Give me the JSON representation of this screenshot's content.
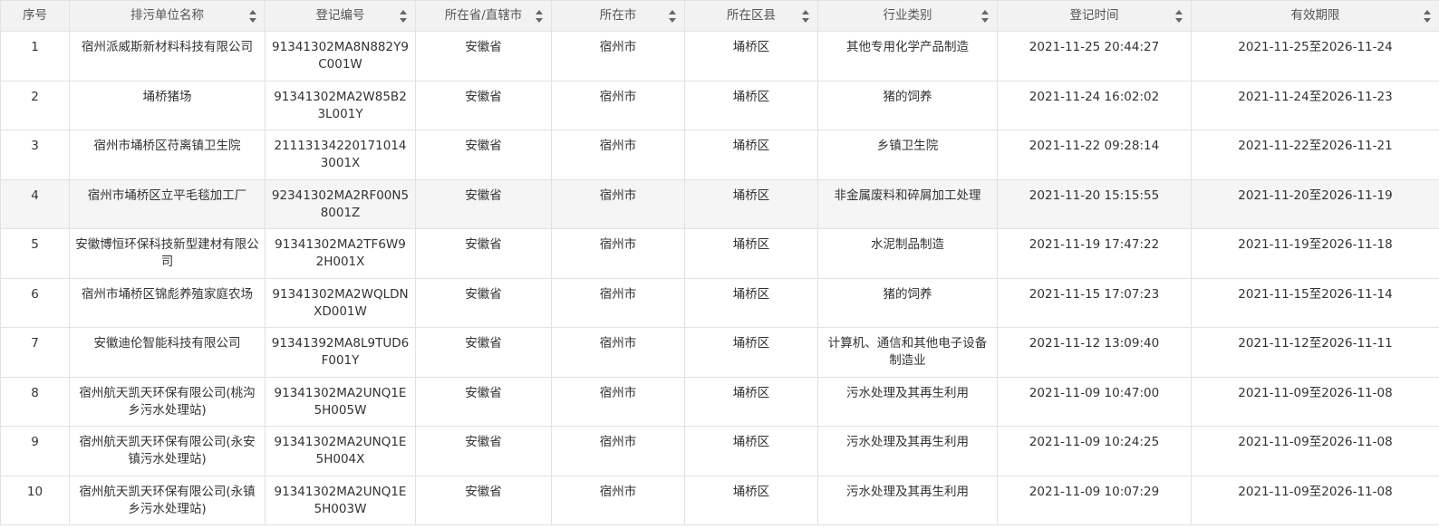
{
  "table": {
    "headers": [
      {
        "key": "seq",
        "label": "序号",
        "sortable": false
      },
      {
        "key": "name",
        "label": "排污单位名称",
        "sortable": true
      },
      {
        "key": "reg_no",
        "label": "登记编号",
        "sortable": true
      },
      {
        "key": "province",
        "label": "所在省/直辖市",
        "sortable": true
      },
      {
        "key": "city",
        "label": "所在市",
        "sortable": true
      },
      {
        "key": "district",
        "label": "所在区县",
        "sortable": true
      },
      {
        "key": "industry",
        "label": "行业类别",
        "sortable": true
      },
      {
        "key": "reg_time",
        "label": "登记时间",
        "sortable": true
      },
      {
        "key": "valid",
        "label": "有效期限",
        "sortable": true
      }
    ],
    "rows": [
      {
        "seq": "1",
        "name": "宿州派威斯新材料科技有限公司",
        "reg_no": "91341302MA8N882Y9C001W",
        "province": "安徽省",
        "city": "宿州市",
        "district": "埇桥区",
        "industry": "其他专用化学产品制造",
        "reg_time": "2021-11-25 20:44:27",
        "valid": "2021-11-25至2026-11-24"
      },
      {
        "seq": "2",
        "name": "埇桥猪场",
        "reg_no": "91341302MA2W85B23L001Y",
        "province": "安徽省",
        "city": "宿州市",
        "district": "埇桥区",
        "industry": "猪的饲养",
        "reg_time": "2021-11-24 16:02:02",
        "valid": "2021-11-24至2026-11-23"
      },
      {
        "seq": "3",
        "name": "宿州市埇桥区苻离镇卫生院",
        "reg_no": "211131342201710143001X",
        "province": "安徽省",
        "city": "宿州市",
        "district": "埇桥区",
        "industry": "乡镇卫生院",
        "reg_time": "2021-11-22 09:28:14",
        "valid": "2021-11-22至2026-11-21"
      },
      {
        "seq": "4",
        "name": "宿州市埇桥区立平毛毯加工厂",
        "reg_no": "92341302MA2RF00N58001Z",
        "province": "安徽省",
        "city": "宿州市",
        "district": "埇桥区",
        "industry": "非金属废料和碎屑加工处理",
        "reg_time": "2021-11-20 15:15:55",
        "valid": "2021-11-20至2026-11-19"
      },
      {
        "seq": "5",
        "name": "安徽博恒环保科技新型建材有限公司",
        "reg_no": "91341302MA2TF6W92H001X",
        "province": "安徽省",
        "city": "宿州市",
        "district": "埇桥区",
        "industry": "水泥制品制造",
        "reg_time": "2021-11-19 17:47:22",
        "valid": "2021-11-19至2026-11-18"
      },
      {
        "seq": "6",
        "name": "宿州市埇桥区锦彪养殖家庭农场",
        "reg_no": "91341302MA2WQLDNXD001W",
        "province": "安徽省",
        "city": "宿州市",
        "district": "埇桥区",
        "industry": "猪的饲养",
        "reg_time": "2021-11-15 17:07:23",
        "valid": "2021-11-15至2026-11-14"
      },
      {
        "seq": "7",
        "name": "安徽迪伦智能科技有限公司",
        "reg_no": "91341392MA8L9TUD6F001Y",
        "province": "安徽省",
        "city": "宿州市",
        "district": "埇桥区",
        "industry": "计算机、通信和其他电子设备制造业",
        "reg_time": "2021-11-12 13:09:40",
        "valid": "2021-11-12至2026-11-11"
      },
      {
        "seq": "8",
        "name": "宿州航天凯天环保有限公司(桃沟乡污水处理站)",
        "reg_no": "91341302MA2UNQ1E5H005W",
        "province": "安徽省",
        "city": "宿州市",
        "district": "埇桥区",
        "industry": "污水处理及其再生利用",
        "reg_time": "2021-11-09 10:47:00",
        "valid": "2021-11-09至2026-11-08"
      },
      {
        "seq": "9",
        "name": "宿州航天凯天环保有限公司(永安镇污水处理站)",
        "reg_no": "91341302MA2UNQ1E5H004X",
        "province": "安徽省",
        "city": "宿州市",
        "district": "埇桥区",
        "industry": "污水处理及其再生利用",
        "reg_time": "2021-11-09 10:24:25",
        "valid": "2021-11-09至2026-11-08"
      },
      {
        "seq": "10",
        "name": "宿州航天凯天环保有限公司(永镇乡污水处理站)",
        "reg_no": "91341302MA2UNQ1E5H003W",
        "province": "安徽省",
        "city": "宿州市",
        "district": "埇桥区",
        "industry": "污水处理及其再生利用",
        "reg_time": "2021-11-09 10:07:29",
        "valid": "2021-11-09至2026-11-08"
      }
    ],
    "highlighted_row": 3
  },
  "colors": {
    "header_bg": "#f2f2f2",
    "border": "#e2e2e2",
    "text": "#333333",
    "highlight_row_bg": "#f5f5f5",
    "sort_icon": "#666666"
  }
}
